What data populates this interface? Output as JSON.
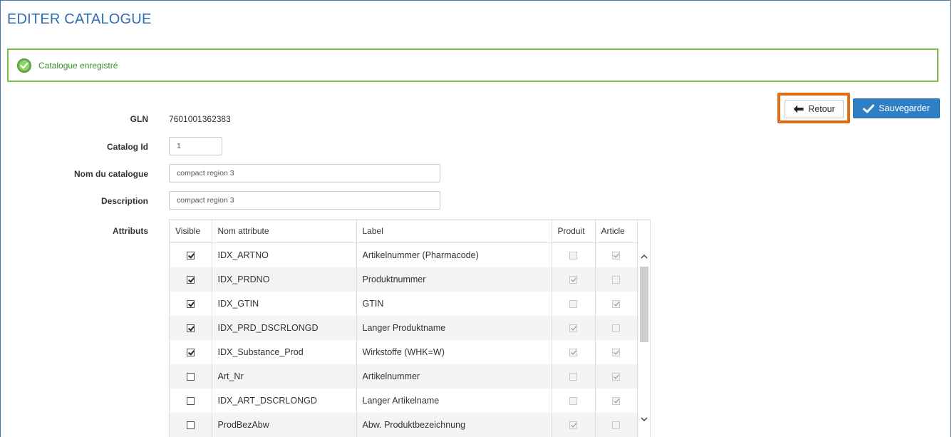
{
  "page": {
    "title": "EDITER CATALOGUE"
  },
  "alert": {
    "message": "Catalogue enregistré",
    "color": "#7dbd4a"
  },
  "actions": {
    "back_label": "Retour",
    "save_label": "Sauvegarder",
    "highlight_color": "#e36b12"
  },
  "form": {
    "gln_label": "GLN",
    "gln_value": "7601001362383",
    "catalog_id_label": "Catalog Id",
    "catalog_id_value": "1",
    "name_label": "Nom du catalogue",
    "name_value": "compact region 3",
    "description_label": "Description",
    "description_value": "compact region 3",
    "attributes_label": "Attributs"
  },
  "table": {
    "columns": [
      "Visible",
      "Nom attribute",
      "Label",
      "Produit",
      "Article"
    ],
    "rows": [
      {
        "visible": true,
        "name": "IDX_ARTNO",
        "label": "Artikelnummer (Pharmacode)",
        "produit": false,
        "article": true
      },
      {
        "visible": true,
        "name": "IDX_PRDNO",
        "label": "Produktnummer",
        "produit": true,
        "article": false
      },
      {
        "visible": true,
        "name": "IDX_GTIN",
        "label": "GTIN",
        "produit": false,
        "article": true
      },
      {
        "visible": true,
        "name": "IDX_PRD_DSCRLONGD",
        "label": "Langer Produktname",
        "produit": true,
        "article": false
      },
      {
        "visible": true,
        "name": "IDX_Substance_Prod",
        "label": "Wirkstoffe (WHK=W)",
        "produit": true,
        "article": true
      },
      {
        "visible": false,
        "name": "Art_Nr",
        "label": "Artikelnummer",
        "produit": false,
        "article": true
      },
      {
        "visible": false,
        "name": "IDX_ART_DSCRLONGD",
        "label": "Langer Artikelname",
        "produit": false,
        "article": true
      },
      {
        "visible": false,
        "name": "ProdBezAbw",
        "label": "Abw. Produktbezeichnung",
        "produit": true,
        "article": false
      }
    ]
  }
}
